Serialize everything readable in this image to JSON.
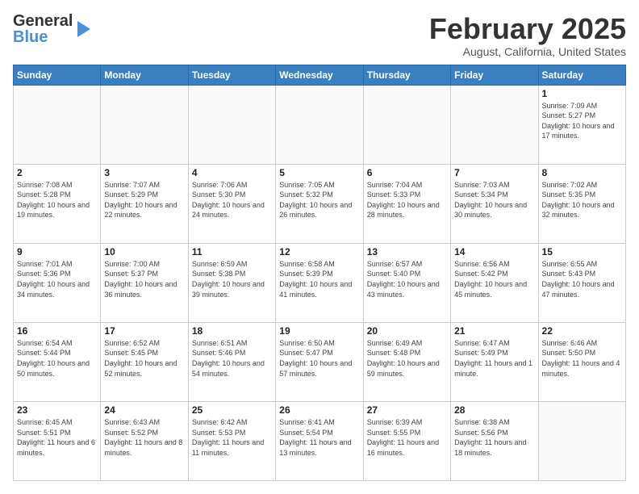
{
  "header": {
    "logo_line1": "General",
    "logo_line2": "Blue",
    "month_title": "February 2025",
    "subtitle": "August, California, United States"
  },
  "days_of_week": [
    "Sunday",
    "Monday",
    "Tuesday",
    "Wednesday",
    "Thursday",
    "Friday",
    "Saturday"
  ],
  "weeks": [
    [
      {
        "day": "",
        "info": ""
      },
      {
        "day": "",
        "info": ""
      },
      {
        "day": "",
        "info": ""
      },
      {
        "day": "",
        "info": ""
      },
      {
        "day": "",
        "info": ""
      },
      {
        "day": "",
        "info": ""
      },
      {
        "day": "1",
        "info": "Sunrise: 7:09 AM\nSunset: 5:27 PM\nDaylight: 10 hours and 17 minutes."
      }
    ],
    [
      {
        "day": "2",
        "info": "Sunrise: 7:08 AM\nSunset: 5:28 PM\nDaylight: 10 hours and 19 minutes."
      },
      {
        "day": "3",
        "info": "Sunrise: 7:07 AM\nSunset: 5:29 PM\nDaylight: 10 hours and 22 minutes."
      },
      {
        "day": "4",
        "info": "Sunrise: 7:06 AM\nSunset: 5:30 PM\nDaylight: 10 hours and 24 minutes."
      },
      {
        "day": "5",
        "info": "Sunrise: 7:05 AM\nSunset: 5:32 PM\nDaylight: 10 hours and 26 minutes."
      },
      {
        "day": "6",
        "info": "Sunrise: 7:04 AM\nSunset: 5:33 PM\nDaylight: 10 hours and 28 minutes."
      },
      {
        "day": "7",
        "info": "Sunrise: 7:03 AM\nSunset: 5:34 PM\nDaylight: 10 hours and 30 minutes."
      },
      {
        "day": "8",
        "info": "Sunrise: 7:02 AM\nSunset: 5:35 PM\nDaylight: 10 hours and 32 minutes."
      }
    ],
    [
      {
        "day": "9",
        "info": "Sunrise: 7:01 AM\nSunset: 5:36 PM\nDaylight: 10 hours and 34 minutes."
      },
      {
        "day": "10",
        "info": "Sunrise: 7:00 AM\nSunset: 5:37 PM\nDaylight: 10 hours and 36 minutes."
      },
      {
        "day": "11",
        "info": "Sunrise: 6:59 AM\nSunset: 5:38 PM\nDaylight: 10 hours and 39 minutes."
      },
      {
        "day": "12",
        "info": "Sunrise: 6:58 AM\nSunset: 5:39 PM\nDaylight: 10 hours and 41 minutes."
      },
      {
        "day": "13",
        "info": "Sunrise: 6:57 AM\nSunset: 5:40 PM\nDaylight: 10 hours and 43 minutes."
      },
      {
        "day": "14",
        "info": "Sunrise: 6:56 AM\nSunset: 5:42 PM\nDaylight: 10 hours and 45 minutes."
      },
      {
        "day": "15",
        "info": "Sunrise: 6:55 AM\nSunset: 5:43 PM\nDaylight: 10 hours and 47 minutes."
      }
    ],
    [
      {
        "day": "16",
        "info": "Sunrise: 6:54 AM\nSunset: 5:44 PM\nDaylight: 10 hours and 50 minutes."
      },
      {
        "day": "17",
        "info": "Sunrise: 6:52 AM\nSunset: 5:45 PM\nDaylight: 10 hours and 52 minutes."
      },
      {
        "day": "18",
        "info": "Sunrise: 6:51 AM\nSunset: 5:46 PM\nDaylight: 10 hours and 54 minutes."
      },
      {
        "day": "19",
        "info": "Sunrise: 6:50 AM\nSunset: 5:47 PM\nDaylight: 10 hours and 57 minutes."
      },
      {
        "day": "20",
        "info": "Sunrise: 6:49 AM\nSunset: 5:48 PM\nDaylight: 10 hours and 59 minutes."
      },
      {
        "day": "21",
        "info": "Sunrise: 6:47 AM\nSunset: 5:49 PM\nDaylight: 11 hours and 1 minute."
      },
      {
        "day": "22",
        "info": "Sunrise: 6:46 AM\nSunset: 5:50 PM\nDaylight: 11 hours and 4 minutes."
      }
    ],
    [
      {
        "day": "23",
        "info": "Sunrise: 6:45 AM\nSunset: 5:51 PM\nDaylight: 11 hours and 6 minutes."
      },
      {
        "day": "24",
        "info": "Sunrise: 6:43 AM\nSunset: 5:52 PM\nDaylight: 11 hours and 8 minutes."
      },
      {
        "day": "25",
        "info": "Sunrise: 6:42 AM\nSunset: 5:53 PM\nDaylight: 11 hours and 11 minutes."
      },
      {
        "day": "26",
        "info": "Sunrise: 6:41 AM\nSunset: 5:54 PM\nDaylight: 11 hours and 13 minutes."
      },
      {
        "day": "27",
        "info": "Sunrise: 6:39 AM\nSunset: 5:55 PM\nDaylight: 11 hours and 16 minutes."
      },
      {
        "day": "28",
        "info": "Sunrise: 6:38 AM\nSunset: 5:56 PM\nDaylight: 11 hours and 18 minutes."
      },
      {
        "day": "",
        "info": ""
      }
    ]
  ]
}
